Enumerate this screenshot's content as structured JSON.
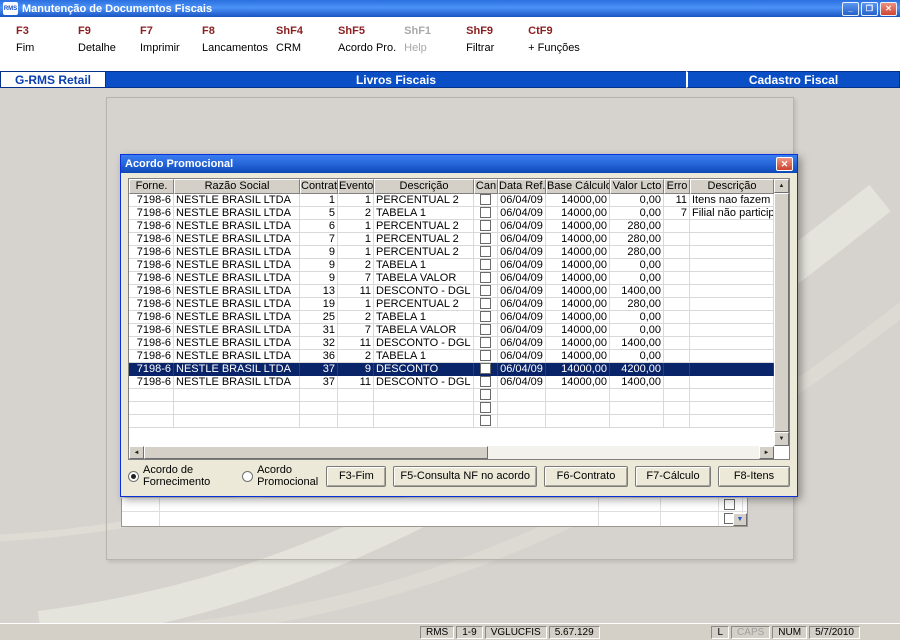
{
  "window": {
    "title": "Manutenção de Documentos Fiscais",
    "icon_text": "RMS",
    "controls": {
      "minimize": "_",
      "maximize": "❐",
      "close": "✕"
    }
  },
  "toolbar": {
    "items": [
      {
        "key": "F3",
        "label": "Fim",
        "enabled": true
      },
      {
        "key": "F9",
        "label": "Detalhe",
        "enabled": true
      },
      {
        "key": "F7",
        "label": "Imprimir",
        "enabled": true
      },
      {
        "key": "F8",
        "label": "Lancamentos",
        "enabled": true
      },
      {
        "key": "ShF4",
        "label": "CRM",
        "enabled": true
      },
      {
        "key": "ShF5",
        "label": "Acordo Pro.",
        "enabled": true
      },
      {
        "key": "ShF1",
        "label": "Help",
        "enabled": false
      },
      {
        "key": "ShF9",
        "label": "Filtrar",
        "enabled": true
      },
      {
        "key": "CtF9",
        "label": "+ Funções",
        "enabled": true
      }
    ]
  },
  "navbar": {
    "left": "G-RMS Retail",
    "center": "Livros Fiscais",
    "right": "Cadastro Fiscal"
  },
  "dialog": {
    "title": "Acordo Promocional",
    "columns": [
      "Forne.",
      "Razão Social",
      "Contrato",
      "Evento",
      "Descrição",
      "Can",
      "Data Ref.",
      "Base Cálculo",
      "Valor Lcto",
      "Erro",
      "Descrição"
    ],
    "selected_index": 13,
    "empty_rows": 3,
    "rows": [
      {
        "forne": "7198-6",
        "razao": "NESTLE BRASIL LTDA",
        "contrato": "1",
        "evento": "1",
        "descricao": "PERCENTUAL 2",
        "data": "06/04/09",
        "base": "14000,00",
        "valor": "0,00",
        "erro": "11",
        "erro_desc": "Itens nao fazem"
      },
      {
        "forne": "7198-6",
        "razao": "NESTLE BRASIL LTDA",
        "contrato": "5",
        "evento": "2",
        "descricao": "TABELA 1",
        "data": "06/04/09",
        "base": "14000,00",
        "valor": "0,00",
        "erro": "7",
        "erro_desc": "Filial não particip"
      },
      {
        "forne": "7198-6",
        "razao": "NESTLE BRASIL LTDA",
        "contrato": "6",
        "evento": "1",
        "descricao": "PERCENTUAL 2",
        "data": "06/04/09",
        "base": "14000,00",
        "valor": "280,00",
        "erro": "",
        "erro_desc": ""
      },
      {
        "forne": "7198-6",
        "razao": "NESTLE BRASIL LTDA",
        "contrato": "7",
        "evento": "1",
        "descricao": "PERCENTUAL 2",
        "data": "06/04/09",
        "base": "14000,00",
        "valor": "280,00",
        "erro": "",
        "erro_desc": ""
      },
      {
        "forne": "7198-6",
        "razao": "NESTLE BRASIL LTDA",
        "contrato": "9",
        "evento": "1",
        "descricao": "PERCENTUAL 2",
        "data": "06/04/09",
        "base": "14000,00",
        "valor": "280,00",
        "erro": "",
        "erro_desc": ""
      },
      {
        "forne": "7198-6",
        "razao": "NESTLE BRASIL LTDA",
        "contrato": "9",
        "evento": "2",
        "descricao": "TABELA 1",
        "data": "06/04/09",
        "base": "14000,00",
        "valor": "0,00",
        "erro": "",
        "erro_desc": ""
      },
      {
        "forne": "7198-6",
        "razao": "NESTLE BRASIL LTDA",
        "contrato": "9",
        "evento": "7",
        "descricao": "TABELA VALOR",
        "data": "06/04/09",
        "base": "14000,00",
        "valor": "0,00",
        "erro": "",
        "erro_desc": ""
      },
      {
        "forne": "7198-6",
        "razao": "NESTLE BRASIL LTDA",
        "contrato": "13",
        "evento": "11",
        "descricao": "DESCONTO - DGL",
        "data": "06/04/09",
        "base": "14000,00",
        "valor": "1400,00",
        "erro": "",
        "erro_desc": ""
      },
      {
        "forne": "7198-6",
        "razao": "NESTLE BRASIL LTDA",
        "contrato": "19",
        "evento": "1",
        "descricao": "PERCENTUAL 2",
        "data": "06/04/09",
        "base": "14000,00",
        "valor": "280,00",
        "erro": "",
        "erro_desc": ""
      },
      {
        "forne": "7198-6",
        "razao": "NESTLE BRASIL LTDA",
        "contrato": "25",
        "evento": "2",
        "descricao": "TABELA 1",
        "data": "06/04/09",
        "base": "14000,00",
        "valor": "0,00",
        "erro": "",
        "erro_desc": ""
      },
      {
        "forne": "7198-6",
        "razao": "NESTLE BRASIL LTDA",
        "contrato": "31",
        "evento": "7",
        "descricao": "TABELA VALOR",
        "data": "06/04/09",
        "base": "14000,00",
        "valor": "0,00",
        "erro": "",
        "erro_desc": ""
      },
      {
        "forne": "7198-6",
        "razao": "NESTLE BRASIL LTDA",
        "contrato": "32",
        "evento": "11",
        "descricao": "DESCONTO - DGL",
        "data": "06/04/09",
        "base": "14000,00",
        "valor": "1400,00",
        "erro": "",
        "erro_desc": ""
      },
      {
        "forne": "7198-6",
        "razao": "NESTLE BRASIL LTDA",
        "contrato": "36",
        "evento": "2",
        "descricao": "TABELA 1",
        "data": "06/04/09",
        "base": "14000,00",
        "valor": "0,00",
        "erro": "",
        "erro_desc": ""
      },
      {
        "forne": "7198-6",
        "razao": "NESTLE BRASIL LTDA",
        "contrato": "37",
        "evento": "9",
        "descricao": "DESCONTO",
        "data": "06/04/09",
        "base": "14000,00",
        "valor": "4200,00",
        "erro": "",
        "erro_desc": ""
      },
      {
        "forne": "7198-6",
        "razao": "NESTLE BRASIL LTDA",
        "contrato": "37",
        "evento": "11",
        "descricao": "DESCONTO - DGL",
        "data": "06/04/09",
        "base": "14000,00",
        "valor": "1400,00",
        "erro": "",
        "erro_desc": ""
      }
    ],
    "radios": [
      {
        "label": "Acordo de Fornecimento",
        "checked": true
      },
      {
        "label": "Acordo Promocional",
        "checked": false
      }
    ],
    "buttons": [
      "F3-Fim",
      "F5-Consulta NF no acordo",
      "F6-Contrato",
      "F7-Cálculo",
      "F8-Itens"
    ]
  },
  "statusbar": {
    "left_panels": [
      "RMS",
      "1-9",
      "VGLUCFIS",
      "5.67.129"
    ],
    "right_panels": [
      {
        "label": "L",
        "dim": false
      },
      {
        "label": "CAPS",
        "dim": true
      },
      {
        "label": "NUM",
        "dim": false
      },
      {
        "label": "5/7/2010",
        "dim": false
      }
    ]
  },
  "colors": {
    "titlebar_blue": "#2a6fe0",
    "navbar_blue": "#0b4fc7",
    "selection_navy": "#0a246a",
    "function_key_red": "#8b1f1f",
    "dialog_bg": "#ece9d8",
    "workspace_gray": "#d6d3ce"
  }
}
